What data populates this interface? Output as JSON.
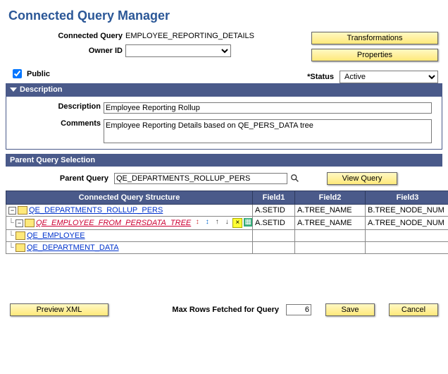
{
  "page_title": "Connected Query Manager",
  "header": {
    "connected_query_label": "Connected Query",
    "connected_query_value": "EMPLOYEE_REPORTING_DETAILS",
    "owner_id_label": "Owner ID",
    "owner_id_value": "",
    "transformations_btn": "Transformations",
    "properties_btn": "Properties",
    "public_label": "Public",
    "public_checked": true,
    "status_label": "*Status",
    "status_value": "Active"
  },
  "description_section": {
    "title": "Description",
    "description_label": "Description",
    "description_value": "Employee Reporting Rollup",
    "comments_label": "Comments",
    "comments_value": "Employee Reporting Details based on QE_PERS_DATA tree"
  },
  "parent_section": {
    "title": "Parent Query Selection",
    "parent_query_label": "Parent Query",
    "parent_query_value": "QE_DEPARTMENTS_ROLLUP_PERS",
    "view_query_btn": "View Query"
  },
  "tree_table": {
    "headers": {
      "structure": "Connected Query Structure",
      "field1": "Field1",
      "field2": "Field2",
      "field3": "Field3"
    },
    "rows": [
      {
        "label": "QE_DEPARTMENTS_ROLLUP_PERS",
        "field1": "A.SETID",
        "field2": "A.TREE_NAME",
        "field3": "B.TREE_NODE_NUM",
        "level": 1,
        "expander": "-",
        "active": false,
        "tools": false
      },
      {
        "label": "QE_EMPLOYEE_FROM_PERSDATA_TREE",
        "field1": "A.SETID",
        "field2": "A.TREE_NAME",
        "field3": "A.TREE_NODE_NUM",
        "level": 2,
        "expander": "-",
        "active": true,
        "tools": true
      },
      {
        "label": "QE_EMPLOYEE",
        "field1": "",
        "field2": "",
        "field3": "",
        "level": 3,
        "expander": "",
        "active": false,
        "tools": false
      },
      {
        "label": "QE_DEPARTMENT_DATA",
        "field1": "",
        "field2": "",
        "field3": "",
        "level": 3,
        "expander": "",
        "active": false,
        "tools": false
      }
    ]
  },
  "footer": {
    "preview_btn": "Preview XML",
    "max_rows_label": "Max Rows Fetched for Query",
    "max_rows_value": "6",
    "save_btn": "Save",
    "cancel_btn": "Cancel"
  }
}
